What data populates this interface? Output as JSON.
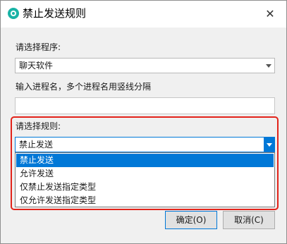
{
  "window": {
    "title": "禁止发送规则",
    "close_glyph": "✕"
  },
  "program": {
    "label": "请选择程序:",
    "selected": "聊天软件"
  },
  "process": {
    "label": "输入进程名，多个进程名用竖线分隔",
    "value": ""
  },
  "rule": {
    "label": "请选择规则:",
    "selected": "禁止发送",
    "options": [
      "禁止发送",
      "允许发送",
      "仅禁止发送指定类型",
      "仅允许发送指定类型"
    ],
    "highlighted_index": 0
  },
  "buttons": {
    "ok": "确定(O)",
    "cancel": "取消(C)"
  },
  "colors": {
    "accent": "#0078d7",
    "highlight_frame": "#e2231a",
    "icon": "#19b3a6"
  }
}
